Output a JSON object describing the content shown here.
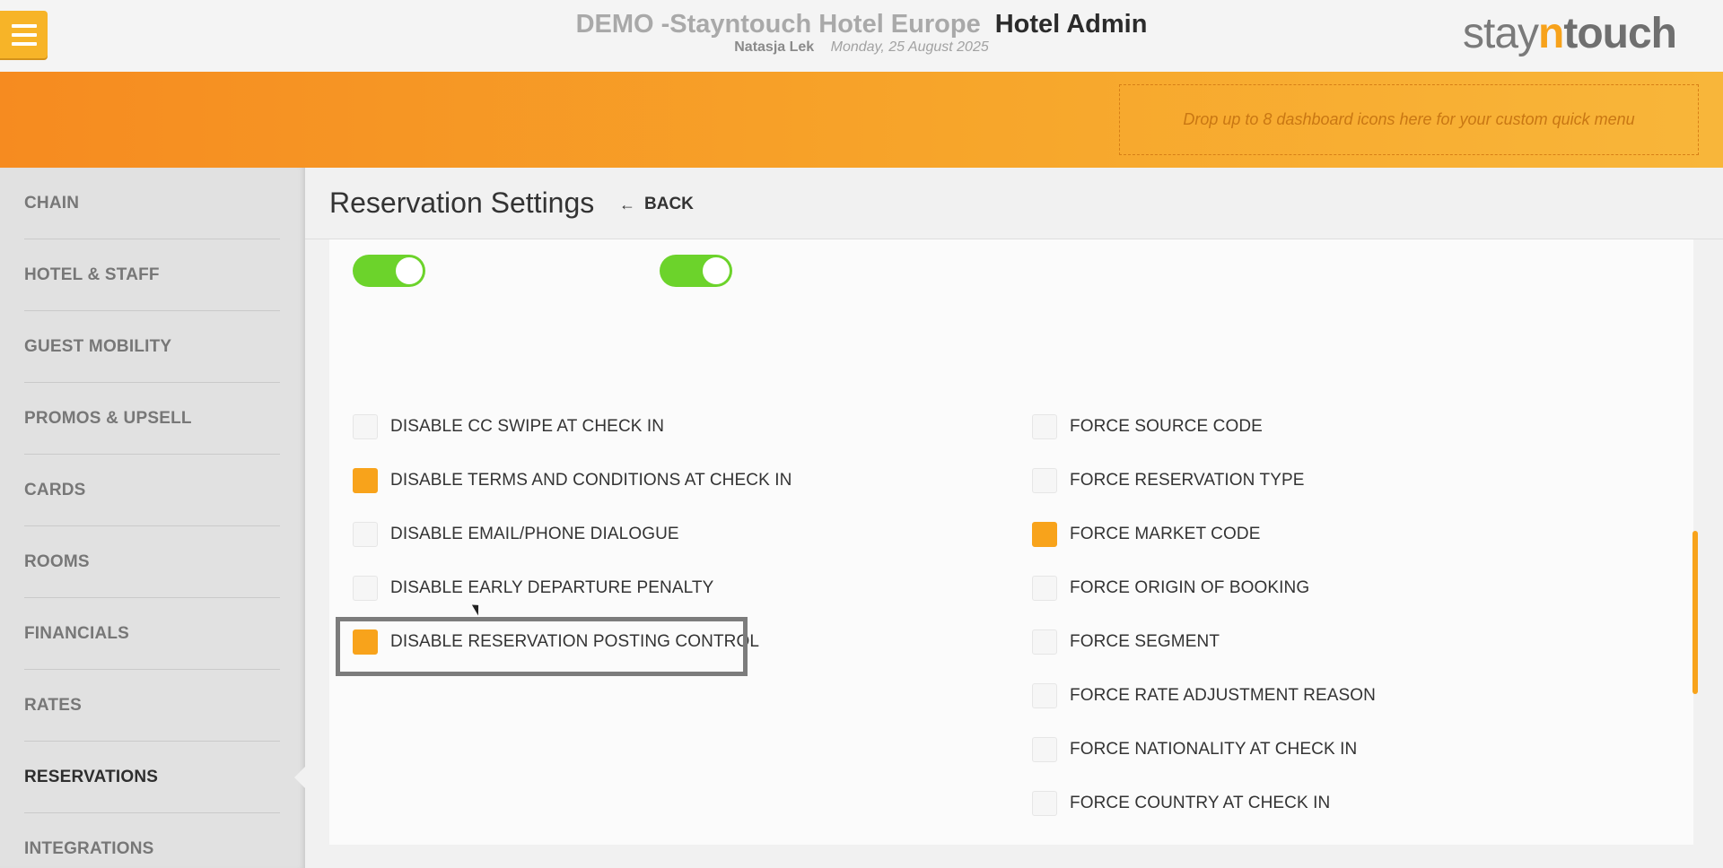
{
  "header": {
    "hotel_name": "DEMO -Stayntouch Hotel Europe",
    "app_name": "Hotel Admin",
    "user": "Natasja Lek",
    "date": "Monday, 25 August 2025",
    "logo": {
      "part1": "stay",
      "part2": "n",
      "part3": "touch"
    }
  },
  "banner": {
    "dropzone_text": "Drop up to 8 dashboard icons here for your custom quick menu"
  },
  "sidebar": {
    "items": [
      {
        "label": "CHAIN"
      },
      {
        "label": "HOTEL & STAFF"
      },
      {
        "label": "GUEST MOBILITY"
      },
      {
        "label": "PROMOS & UPSELL"
      },
      {
        "label": "CARDS"
      },
      {
        "label": "ROOMS"
      },
      {
        "label": "FINANCIALS"
      },
      {
        "label": "RATES"
      },
      {
        "label": "RESERVATIONS",
        "active": true
      },
      {
        "label": "INTEGRATIONS"
      }
    ]
  },
  "page": {
    "title": "Reservation Settings",
    "back_label": "BACK"
  },
  "toggles": [
    {
      "state": "on"
    },
    {
      "state": "on"
    }
  ],
  "left_options": [
    {
      "label": "DISABLE CC SWIPE AT CHECK IN",
      "checked": false
    },
    {
      "label": "DISABLE TERMS AND CONDITIONS AT CHECK IN",
      "checked": true
    },
    {
      "label": "DISABLE EMAIL/PHONE DIALOGUE",
      "checked": false
    },
    {
      "label": "DISABLE EARLY DEPARTURE PENALTY",
      "checked": false
    },
    {
      "label": "DISABLE RESERVATION POSTING CONTROL",
      "checked": true
    }
  ],
  "right_options": [
    {
      "label": "FORCE SOURCE CODE",
      "checked": false
    },
    {
      "label": "FORCE RESERVATION TYPE",
      "checked": false
    },
    {
      "label": "FORCE MARKET CODE",
      "checked": true
    },
    {
      "label": "FORCE ORIGIN OF BOOKING",
      "checked": false
    },
    {
      "label": "FORCE SEGMENT",
      "checked": false
    },
    {
      "label": "FORCE RATE ADJUSTMENT REASON",
      "checked": false
    },
    {
      "label": "FORCE NATIONALITY AT CHECK IN",
      "checked": false
    },
    {
      "label": "FORCE COUNTRY AT CHECK IN",
      "checked": false
    }
  ],
  "colors": {
    "accent": "#f8a31b",
    "toggle_on": "#6cd32b",
    "banner_start": "#f68b20",
    "banner_end": "#f8b63a"
  }
}
